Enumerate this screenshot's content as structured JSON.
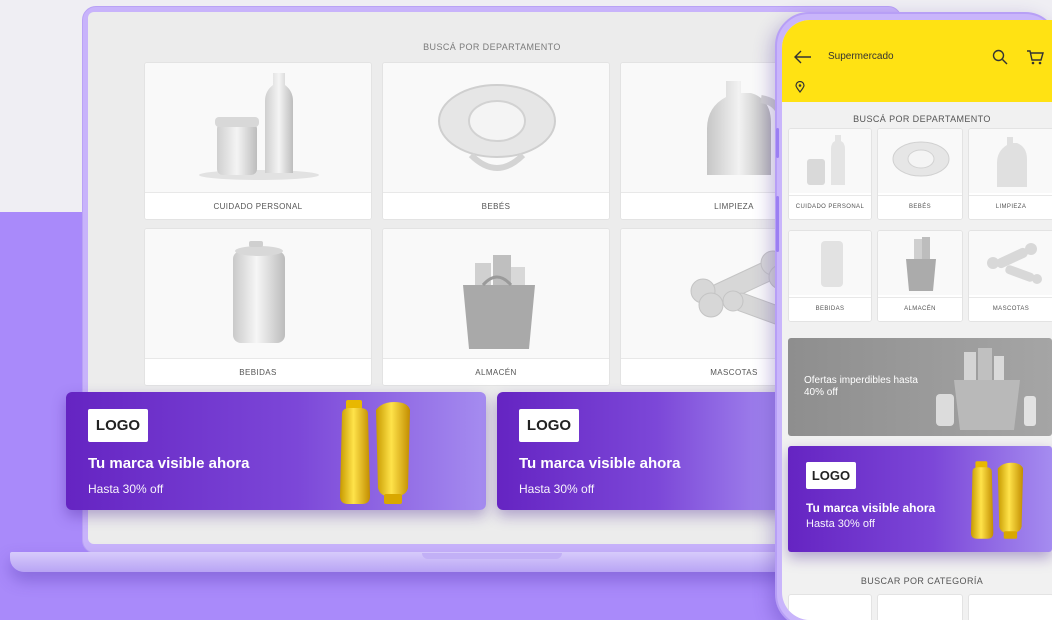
{
  "desktop": {
    "section_title": "BUSCÁ POR DEPARTAMENTO",
    "departments": [
      {
        "label": "CUIDADO PERSONAL"
      },
      {
        "label": "BEBÉS"
      },
      {
        "label": "LIMPIEZA"
      },
      {
        "label": "BEBIDAS"
      },
      {
        "label": "ALMACÉN"
      },
      {
        "label": "MASCOTAS"
      }
    ],
    "banners": [
      {
        "logo": "LOGO",
        "headline": "Tu marca visible ahora",
        "sub": "Hasta 30% off"
      },
      {
        "logo": "LOGO",
        "headline": "Tu marca visible ahora",
        "sub": "Hasta 30% off"
      }
    ]
  },
  "mobile": {
    "header": {
      "title": "Supermercado",
      "back_icon": "arrow-left-icon",
      "search_icon": "search-icon",
      "cart_icon": "cart-icon",
      "location_icon": "location-pin-icon"
    },
    "section_title": "BUSCÁ POR DEPARTAMENTO",
    "departments": [
      {
        "label": "CUIDADO PERSONAL"
      },
      {
        "label": "BEBÉS"
      },
      {
        "label": "LIMPIEZA"
      },
      {
        "label": "BEBIDAS"
      },
      {
        "label": "ALMACÉN"
      },
      {
        "label": "MASCOTAS"
      }
    ],
    "promo": {
      "text": "Ofertas imperdibles hasta 40% off"
    },
    "banner": {
      "logo": "LOGO",
      "headline": "Tu marca visible ahora",
      "sub": "Hasta 30% off"
    },
    "category_title": "BUSCAR POR CATEGORÍA"
  },
  "colors": {
    "brand_purple": "#7b3fe0",
    "header_yellow": "#ffe213",
    "background_purple": "#a98afa"
  }
}
